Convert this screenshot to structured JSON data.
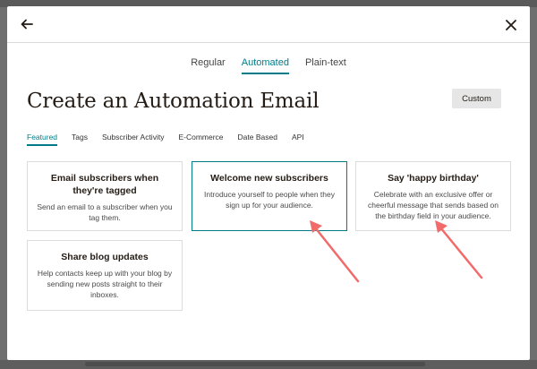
{
  "header": {
    "back_icon": "arrow-left-icon",
    "close_icon": "close-x-icon"
  },
  "email_types": [
    {
      "label": "Regular",
      "active": false
    },
    {
      "label": "Automated",
      "active": true
    },
    {
      "label": "Plain-text",
      "active": false
    }
  ],
  "title": "Create an Automation Email",
  "custom_button": "Custom",
  "categories": [
    {
      "label": "Featured",
      "active": true
    },
    {
      "label": "Tags",
      "active": false
    },
    {
      "label": "Subscriber Activity",
      "active": false
    },
    {
      "label": "E-Commerce",
      "active": false
    },
    {
      "label": "Date Based",
      "active": false
    },
    {
      "label": "API",
      "active": false
    }
  ],
  "cards": [
    {
      "title": "Email subscribers when they're tagged",
      "description": "Send an email to a subscriber when you tag them.",
      "selected": false
    },
    {
      "title": "Welcome new subscribers",
      "description": "Introduce yourself to people when they sign up for your audience.",
      "selected": true
    },
    {
      "title": "Say 'happy birthday'",
      "description": "Celebrate with an exclusive offer or cheerful message that sends based on the birthday field in your audience.",
      "selected": false
    },
    {
      "title": "Share blog updates",
      "description": "Help contacts keep up with your blog by sending new posts straight to their inboxes.",
      "selected": false
    }
  ],
  "colors": {
    "accent": "#007c89",
    "annotation_arrow": "#f26b6b"
  }
}
